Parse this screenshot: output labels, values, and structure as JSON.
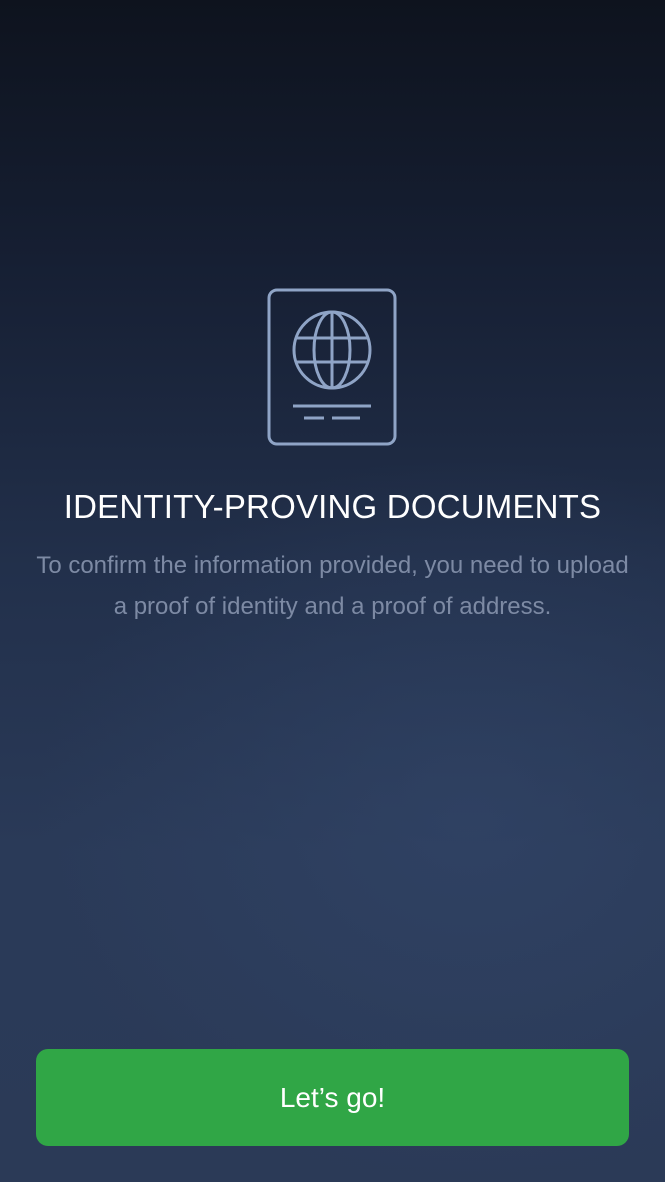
{
  "app": {
    "screen": "onboarding-documents"
  },
  "hero": {
    "icon": "passport-icon",
    "icon_color": "#8fa4c6"
  },
  "content": {
    "title": "IDENTITY-PROVING DOCUMENTS",
    "description": "To confirm the information provided, you need to upload a proof of identity and a proof of address."
  },
  "actions": {
    "primary_label": "Let’s go!",
    "primary_color": "#30a646"
  },
  "theme": {
    "background_top": "#0e131e",
    "background_bottom": "#2b3a57",
    "text_primary": "#ffffff",
    "text_secondary": "#7d8aa4"
  }
}
